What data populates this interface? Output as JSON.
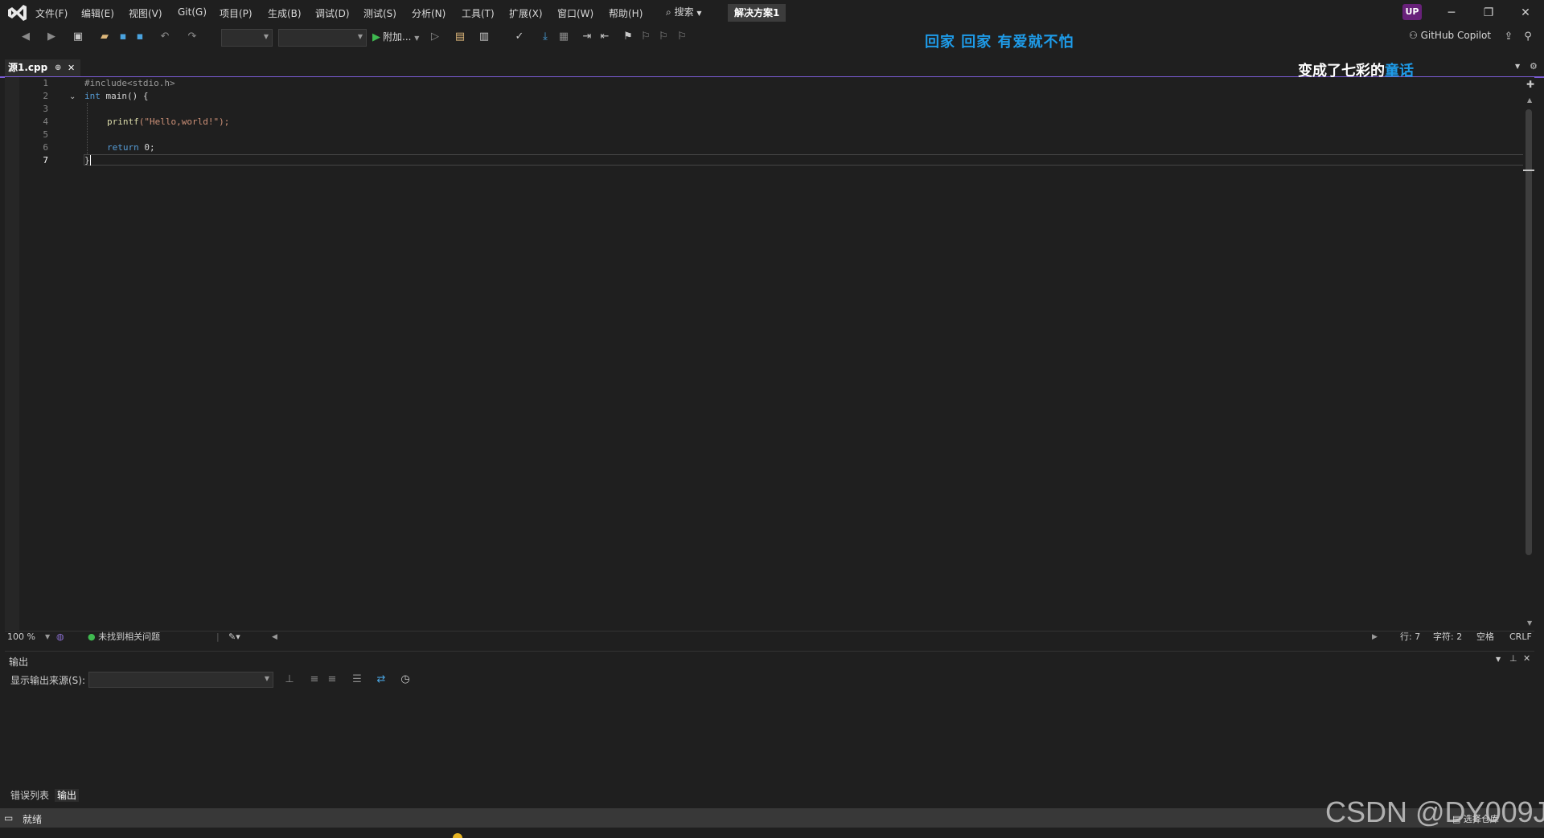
{
  "menu": {
    "items": [
      "文件(F)",
      "编辑(E)",
      "视图(V)",
      "Git(G)",
      "项目(P)",
      "生成(B)",
      "调试(D)",
      "测试(S)",
      "分析(N)",
      "工具(T)",
      "扩展(X)",
      "窗口(W)",
      "帮助(H)"
    ],
    "search_label": "搜索",
    "solution_title": "解决方案1"
  },
  "account": {
    "initials": "UP"
  },
  "toolbar": {
    "run_label": "附加...",
    "copilot_label": "GitHub Copilot"
  },
  "lyrics": {
    "line1": "回家  回家  有爱就不怕",
    "line2_white": "变成了七彩的",
    "line2_blue": "童话"
  },
  "editor": {
    "tab_name": "源1.cpp",
    "line_numbers": [
      "1",
      "2",
      "3",
      "4",
      "5",
      "6",
      "7"
    ],
    "code": {
      "line1": "#include<stdio.h>",
      "line2_kw": "int",
      "line2_rest": " main() {",
      "line4_fn": "printf",
      "line4_str": "(\"Hello,world!\");",
      "line6_kw": "return",
      "line6_rest": " 0;",
      "line7": "}"
    }
  },
  "editor_status": {
    "zoom": "100 %",
    "issues": "未找到相关问题",
    "line": "行: 7",
    "char": "字符: 2",
    "whitespace": "空格",
    "eol": "CRLF"
  },
  "output": {
    "title": "输出",
    "source_label": "显示输出来源(S):",
    "source_value": ""
  },
  "bottom_tabs": [
    "错误列表",
    "输出"
  ],
  "status": {
    "text": "就绪",
    "right_text": "选择仓库"
  },
  "watermark": "CSDN @DY009J"
}
